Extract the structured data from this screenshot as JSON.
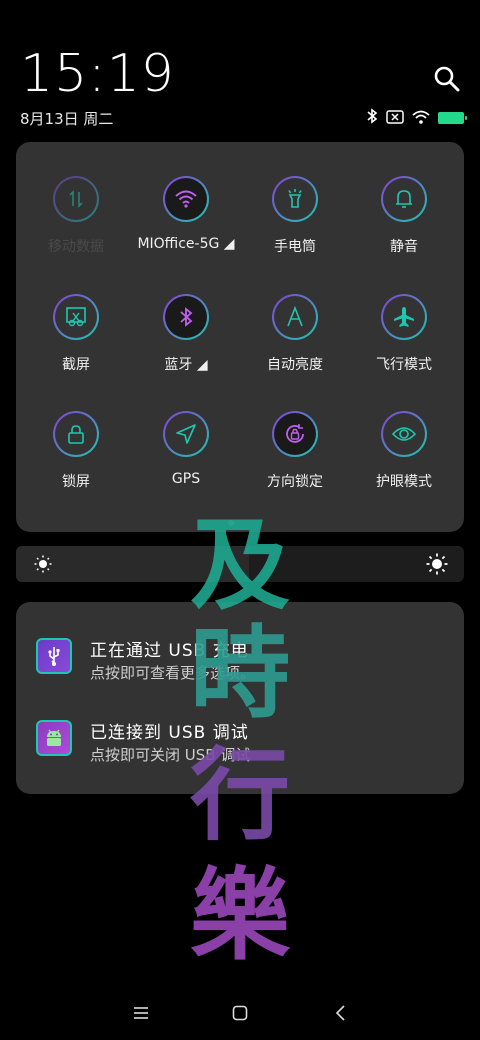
{
  "status": {
    "time": "15:19",
    "date": "8月13日 周二"
  },
  "colors": {
    "accent_teal": "#1ec8b0",
    "accent_purple": "#8a3cd8",
    "battery": "#23d98a"
  },
  "quick_settings": [
    {
      "label": "移动数据",
      "icon": "mobile-data-icon",
      "state": "disabled"
    },
    {
      "label": "MIOffice-5G ◢",
      "icon": "wifi-icon",
      "state": "on"
    },
    {
      "label": "手电筒",
      "icon": "flashlight-icon",
      "state": "off"
    },
    {
      "label": "静音",
      "icon": "bell-icon",
      "state": "off"
    },
    {
      "label": "截屏",
      "icon": "screenshot-icon",
      "state": "off"
    },
    {
      "label": "蓝牙 ◢",
      "icon": "bluetooth-icon",
      "state": "on"
    },
    {
      "label": "自动亮度",
      "icon": "auto-brightness-icon",
      "state": "off"
    },
    {
      "label": "飞行模式",
      "icon": "airplane-icon",
      "state": "off"
    },
    {
      "label": "锁屏",
      "icon": "lock-icon",
      "state": "off"
    },
    {
      "label": "GPS",
      "icon": "location-icon",
      "state": "off"
    },
    {
      "label": "方向锁定",
      "icon": "rotation-lock-icon",
      "state": "on"
    },
    {
      "label": "护眼模式",
      "icon": "eye-icon",
      "state": "off"
    }
  ],
  "brightness": {
    "level": 0.52
  },
  "notifications": [
    {
      "title": "正在通过 USB 充电",
      "subtitle": "点按即可查看更多选项。",
      "icon": "usb-icon"
    },
    {
      "title": "已连接到 USB 调试",
      "subtitle": "点按即可关闭 USB 调试",
      "icon": "android-icon"
    }
  ],
  "watermark": {
    "chars": [
      "及",
      "時",
      "行",
      "樂"
    ]
  }
}
